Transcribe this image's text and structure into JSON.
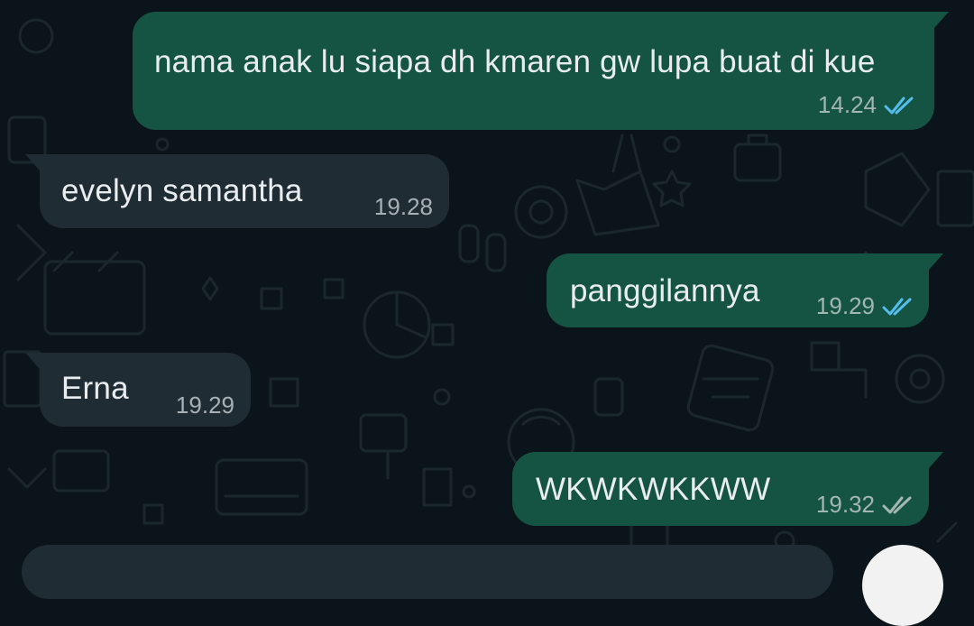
{
  "messages": [
    {
      "direction": "outgoing",
      "text": "nama anak lu siapa dh kmaren gw lupa buat di kue",
      "time": "14.24",
      "status": "read"
    },
    {
      "direction": "incoming",
      "text": "evelyn samantha",
      "time": "19.28"
    },
    {
      "direction": "outgoing",
      "text": "panggilannya",
      "time": "19.29",
      "status": "read"
    },
    {
      "direction": "incoming",
      "text": "Erna",
      "time": "19.29"
    },
    {
      "direction": "outgoing",
      "text": "WKWKWKKWW",
      "time": "19.32",
      "status": "delivered"
    }
  ],
  "colors": {
    "background": "#0b141a",
    "outgoing_bubble": "#155443",
    "incoming_bubble": "#202c33",
    "read_tick": "#53bdeb",
    "delivered_tick": "#a3b6b0"
  },
  "icons": {
    "read_status": "double-check-blue-icon",
    "delivered_status": "double-check-grey-icon"
  }
}
